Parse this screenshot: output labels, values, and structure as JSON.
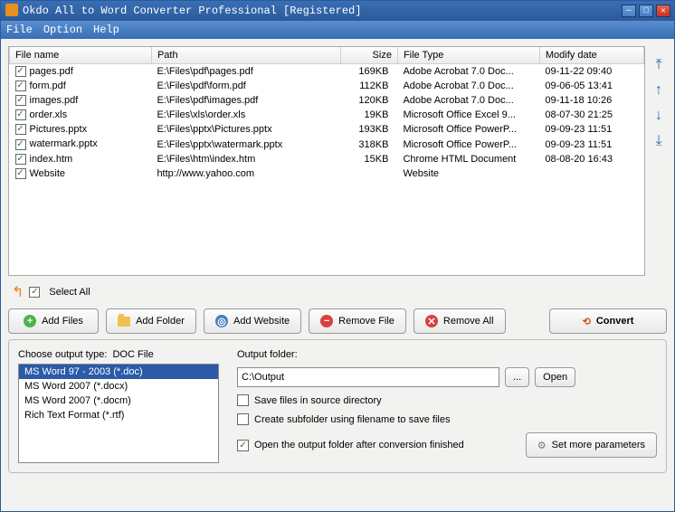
{
  "titlebar": {
    "text": "Okdo All to Word Converter Professional [Registered]"
  },
  "menu": {
    "file": "File",
    "option": "Option",
    "help": "Help"
  },
  "columns": {
    "name": "File name",
    "path": "Path",
    "size": "Size",
    "type": "File Type",
    "date": "Modify date"
  },
  "files": [
    {
      "name": "pages.pdf",
      "path": "E:\\Files\\pdf\\pages.pdf",
      "size": "169KB",
      "type": "Adobe Acrobat 7.0 Doc...",
      "date": "09-11-22 09:40"
    },
    {
      "name": "form.pdf",
      "path": "E:\\Files\\pdf\\form.pdf",
      "size": "112KB",
      "type": "Adobe Acrobat 7.0 Doc...",
      "date": "09-06-05 13:41"
    },
    {
      "name": "images.pdf",
      "path": "E:\\Files\\pdf\\images.pdf",
      "size": "120KB",
      "type": "Adobe Acrobat 7.0 Doc...",
      "date": "09-11-18 10:26"
    },
    {
      "name": "order.xls",
      "path": "E:\\Files\\xls\\order.xls",
      "size": "19KB",
      "type": "Microsoft Office Excel 9...",
      "date": "08-07-30 21:25"
    },
    {
      "name": "Pictures.pptx",
      "path": "E:\\Files\\pptx\\Pictures.pptx",
      "size": "193KB",
      "type": "Microsoft Office PowerP...",
      "date": "09-09-23 11:51"
    },
    {
      "name": "watermark.pptx",
      "path": "E:\\Files\\pptx\\watermark.pptx",
      "size": "318KB",
      "type": "Microsoft Office PowerP...",
      "date": "09-09-23 11:51"
    },
    {
      "name": "index.htm",
      "path": "E:\\Files\\htm\\index.htm",
      "size": "15KB",
      "type": "Chrome HTML Document",
      "date": "08-08-20 16:43"
    },
    {
      "name": "Website",
      "path": "http://www.yahoo.com",
      "size": "",
      "type": "Website",
      "date": ""
    }
  ],
  "selectAll": "Select All",
  "buttons": {
    "addFiles": "Add Files",
    "addFolder": "Add Folder",
    "addWebsite": "Add Website",
    "removeFile": "Remove File",
    "removeAll": "Remove All",
    "convert": "Convert",
    "browse": "...",
    "open": "Open",
    "setParams": "Set more parameters"
  },
  "outputType": {
    "label": "Choose output type:",
    "current": "DOC File"
  },
  "listItems": [
    "MS Word 97 - 2003 (*.doc)",
    "MS Word 2007 (*.docx)",
    "MS Word 2007 (*.docm)",
    "Rich Text Format (*.rtf)"
  ],
  "outputFolder": {
    "label": "Output folder:",
    "value": "C:\\Output"
  },
  "options": {
    "saveSource": "Save files in source directory",
    "createSub": "Create subfolder using filename to save files",
    "openAfter": "Open the output folder after conversion finished"
  }
}
